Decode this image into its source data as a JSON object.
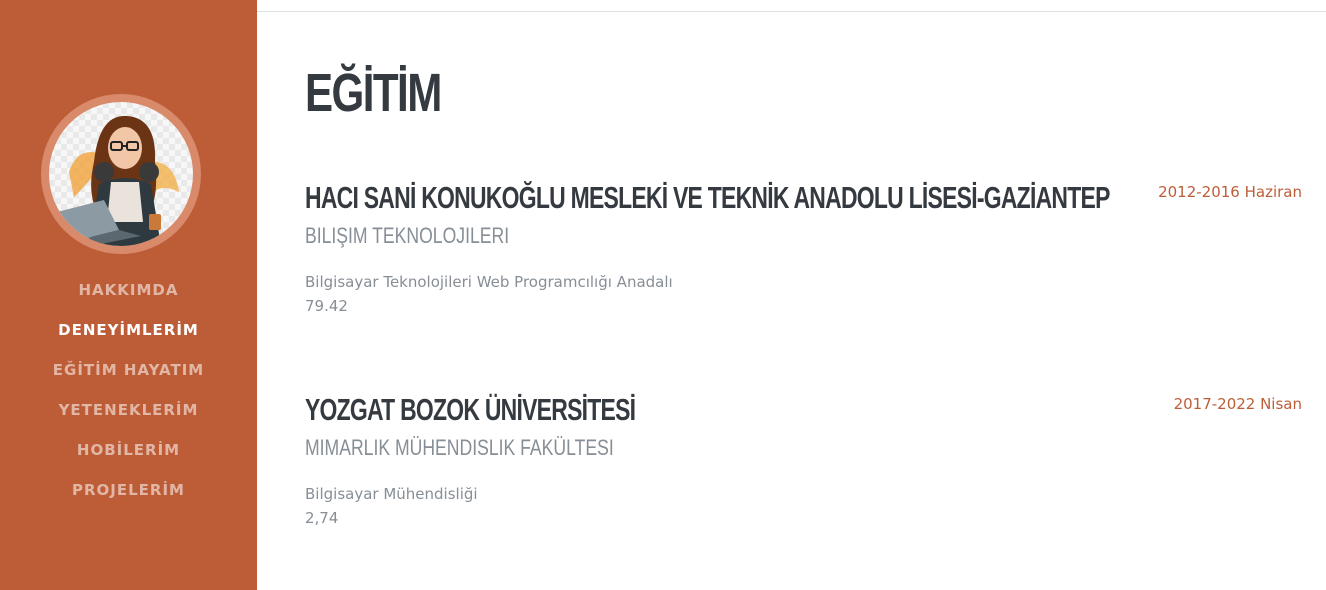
{
  "sidebar": {
    "nav": [
      {
        "label": "HAKKIMDA"
      },
      {
        "label": "DENEYİMLERİM"
      },
      {
        "label": "EĞİTİM HAYATIM"
      },
      {
        "label": "YETENEKLERİM"
      },
      {
        "label": "HOBİLERİM"
      },
      {
        "label": "PROJELERİM"
      }
    ],
    "active_index": 1
  },
  "main": {
    "title": "EĞİTİM",
    "education": [
      {
        "school": "HACI SANİ KONUKOĞLU MESLEKİ VE TEKNİK ANADOLU LİSESİ-GAZİANTEP",
        "department": "BILIŞIM TEKNOLOJILERI",
        "program": "Bilgisayar Teknolojileri Web Programcılığı Anadalı",
        "score": "79.42",
        "date": "2012-2016 Haziran"
      },
      {
        "school": "YOZGAT BOZOK ÜNİVERSİTESİ",
        "department": "MIMARLIK MÜHENDISLIK FAKÜLTESI",
        "program": "Bilgisayar Mühendisliği",
        "score": "2,74",
        "date": "2017-2022 Nisan"
      }
    ]
  },
  "colors": {
    "sidebar": "#bd5d38",
    "accent": "#bd5d38",
    "heading": "#343a40",
    "muted": "#868e96"
  }
}
